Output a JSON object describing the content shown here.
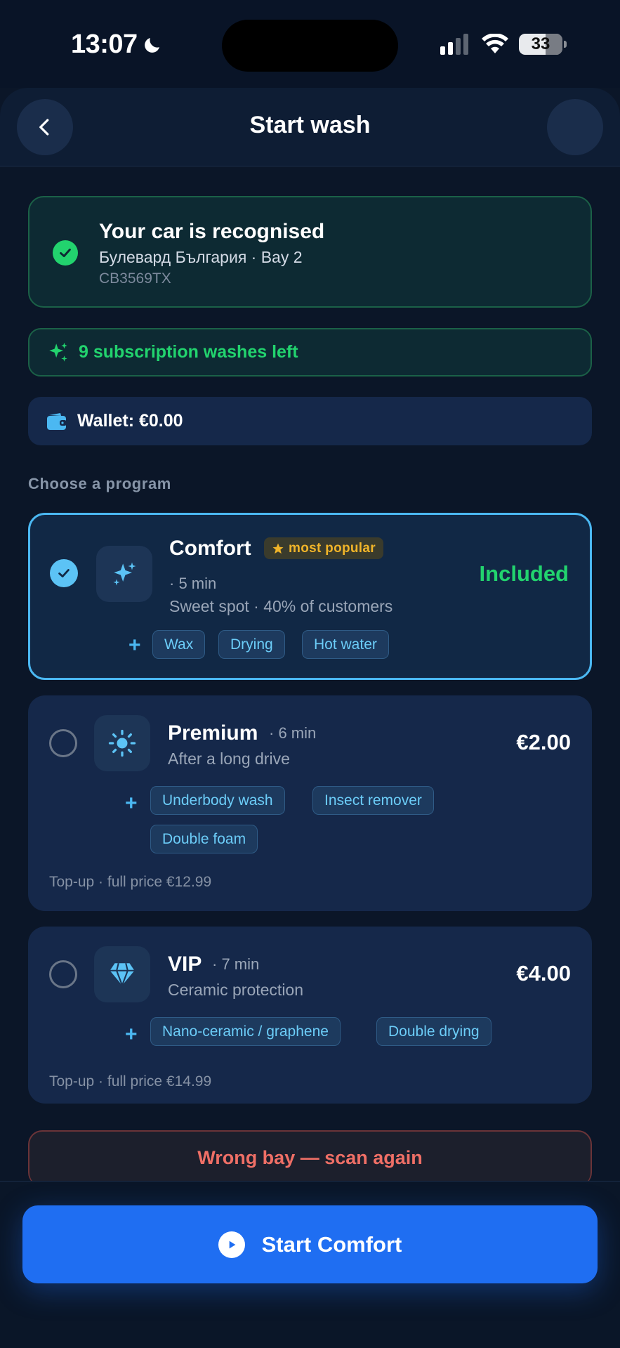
{
  "status_bar": {
    "time": "13:07",
    "battery": "33"
  },
  "header": {
    "title": "Start wash"
  },
  "recognition": {
    "title": "Your car is recognised",
    "location": "Булевард България · Bay 2",
    "plate": "CB3569TX"
  },
  "subscription": {
    "text": "9 subscription washes left"
  },
  "wallet": {
    "text": "Wallet: €0.00"
  },
  "section_label": "Choose a program",
  "programs": [
    {
      "name": "Comfort",
      "badge": "most popular",
      "duration": "· 5 min",
      "description": "Sweet spot · 40% of customers",
      "price": "Included",
      "selected": true,
      "plus": "+",
      "tags": [
        "Wax",
        "Drying",
        "Hot water"
      ]
    },
    {
      "name": "Premium",
      "duration": "· 6 min",
      "description": "After a long drive",
      "price": "€2.00",
      "selected": false,
      "plus": "+",
      "tags": [
        "Underbody wash",
        "Insect remover",
        "Double foam"
      ],
      "footer": "Top-up · full price €12.99"
    },
    {
      "name": "VIP",
      "duration": "· 7 min",
      "description": "Ceramic protection",
      "price": "€4.00",
      "selected": false,
      "plus": "+",
      "tags": [
        "Nano-ceramic / graphene",
        "Double drying"
      ],
      "footer": "Top-up · full price €14.99"
    }
  ],
  "wrong_bay": {
    "label": "Wrong bay — scan again"
  },
  "start_button": {
    "label": "Start Comfort"
  },
  "colors": {
    "background": "#0b1628",
    "success": "#22d36e",
    "accent": "#4bb8f2",
    "primary_button": "#1f6ef2",
    "badge": "#f0b429",
    "danger": "#ef6f66"
  }
}
